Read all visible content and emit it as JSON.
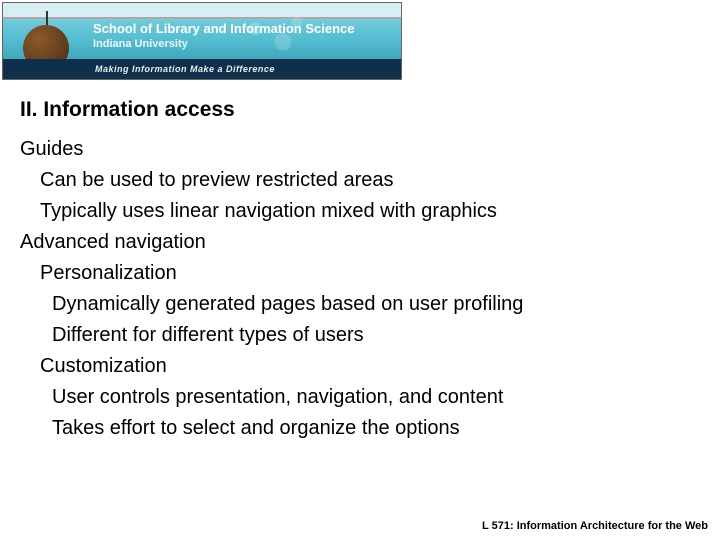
{
  "banner": {
    "line1": "School of Library and Information Science",
    "line2": "Indiana University",
    "tagline": "Making Information Make a Difference"
  },
  "slide": {
    "title": "II.  Information access",
    "lines": [
      {
        "level": 1,
        "text": "Guides"
      },
      {
        "level": 2,
        "text": "Can be used to preview restricted areas"
      },
      {
        "level": 2,
        "text": "Typically uses linear navigation mixed with graphics"
      },
      {
        "level": 1,
        "text": "Advanced navigation"
      },
      {
        "level": 2,
        "text": "Personalization"
      },
      {
        "level": 3,
        "text": "Dynamically generated pages based on user profiling"
      },
      {
        "level": 3,
        "text": "Different for different types of users"
      },
      {
        "level": 2,
        "text": "Customization"
      },
      {
        "level": 3,
        "text": "User controls presentation, navigation, and content"
      },
      {
        "level": 3,
        "text": "Takes effort to select and organize the options"
      }
    ]
  },
  "footer": "L 571: Information Architecture for the Web"
}
